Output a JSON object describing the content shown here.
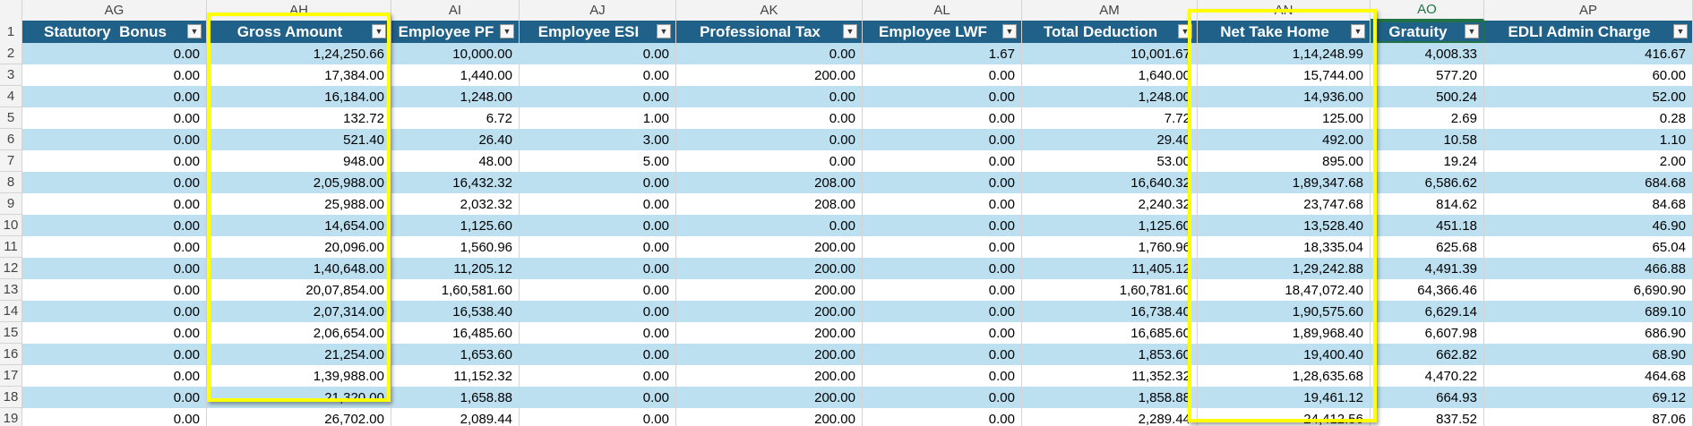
{
  "colors": {
    "header_bg": "#1f6189",
    "band": "#bde0f1",
    "highlight": "#ffff00",
    "active_column": "#217346"
  },
  "column_letters": [
    "AG",
    "AH",
    "AI",
    "AJ",
    "AK",
    "AL",
    "AM",
    "AN",
    "AO",
    "AP"
  ],
  "active_column_index": 8,
  "headers": [
    "Statutory  Bonus",
    "Gross Amount",
    "Employee PF",
    "Employee ESI",
    "Professional Tax",
    "Employee LWF",
    "Total Deduction",
    "Net Take Home",
    "Gratuity",
    "EDLI Admin Charge"
  ],
  "header_row_number": "1",
  "rows": [
    {
      "n": "2",
      "cells": [
        "0.00",
        "1,24,250.66",
        "10,000.00",
        "0.00",
        "0.00",
        "1.67",
        "10,001.67",
        "1,14,248.99",
        "4,008.33",
        "416.67"
      ]
    },
    {
      "n": "3",
      "cells": [
        "0.00",
        "17,384.00",
        "1,440.00",
        "0.00",
        "200.00",
        "0.00",
        "1,640.00",
        "15,744.00",
        "577.20",
        "60.00"
      ]
    },
    {
      "n": "4",
      "cells": [
        "0.00",
        "16,184.00",
        "1,248.00",
        "0.00",
        "0.00",
        "0.00",
        "1,248.00",
        "14,936.00",
        "500.24",
        "52.00"
      ]
    },
    {
      "n": "5",
      "cells": [
        "0.00",
        "132.72",
        "6.72",
        "1.00",
        "0.00",
        "0.00",
        "7.72",
        "125.00",
        "2.69",
        "0.28"
      ]
    },
    {
      "n": "6",
      "cells": [
        "0.00",
        "521.40",
        "26.40",
        "3.00",
        "0.00",
        "0.00",
        "29.40",
        "492.00",
        "10.58",
        "1.10"
      ]
    },
    {
      "n": "7",
      "cells": [
        "0.00",
        "948.00",
        "48.00",
        "5.00",
        "0.00",
        "0.00",
        "53.00",
        "895.00",
        "19.24",
        "2.00"
      ]
    },
    {
      "n": "8",
      "cells": [
        "0.00",
        "2,05,988.00",
        "16,432.32",
        "0.00",
        "208.00",
        "0.00",
        "16,640.32",
        "1,89,347.68",
        "6,586.62",
        "684.68"
      ]
    },
    {
      "n": "9",
      "cells": [
        "0.00",
        "25,988.00",
        "2,032.32",
        "0.00",
        "208.00",
        "0.00",
        "2,240.32",
        "23,747.68",
        "814.62",
        "84.68"
      ]
    },
    {
      "n": "10",
      "cells": [
        "0.00",
        "14,654.00",
        "1,125.60",
        "0.00",
        "0.00",
        "0.00",
        "1,125.60",
        "13,528.40",
        "451.18",
        "46.90"
      ]
    },
    {
      "n": "11",
      "cells": [
        "0.00",
        "20,096.00",
        "1,560.96",
        "0.00",
        "200.00",
        "0.00",
        "1,760.96",
        "18,335.04",
        "625.68",
        "65.04"
      ]
    },
    {
      "n": "12",
      "cells": [
        "0.00",
        "1,40,648.00",
        "11,205.12",
        "0.00",
        "200.00",
        "0.00",
        "11,405.12",
        "1,29,242.88",
        "4,491.39",
        "466.88"
      ]
    },
    {
      "n": "13",
      "cells": [
        "0.00",
        "20,07,854.00",
        "1,60,581.60",
        "0.00",
        "200.00",
        "0.00",
        "1,60,781.60",
        "18,47,072.40",
        "64,366.46",
        "6,690.90"
      ]
    },
    {
      "n": "14",
      "cells": [
        "0.00",
        "2,07,314.00",
        "16,538.40",
        "0.00",
        "200.00",
        "0.00",
        "16,738.40",
        "1,90,575.60",
        "6,629.14",
        "689.10"
      ]
    },
    {
      "n": "15",
      "cells": [
        "0.00",
        "2,06,654.00",
        "16,485.60",
        "0.00",
        "200.00",
        "0.00",
        "16,685.60",
        "1,89,968.40",
        "6,607.98",
        "686.90"
      ]
    },
    {
      "n": "16",
      "cells": [
        "0.00",
        "21,254.00",
        "1,653.60",
        "0.00",
        "200.00",
        "0.00",
        "1,853.60",
        "19,400.40",
        "662.82",
        "68.90"
      ]
    },
    {
      "n": "17",
      "cells": [
        "0.00",
        "1,39,988.00",
        "11,152.32",
        "0.00",
        "200.00",
        "0.00",
        "11,352.32",
        "1,28,635.68",
        "4,470.22",
        "464.68"
      ]
    },
    {
      "n": "18",
      "cells": [
        "0.00",
        "21,320.00",
        "1,658.88",
        "0.00",
        "200.00",
        "0.00",
        "1,858.88",
        "19,461.12",
        "664.93",
        "69.12"
      ]
    },
    {
      "n": "19",
      "cells": [
        "0.00",
        "26,702.00",
        "2,089.44",
        "0.00",
        "200.00",
        "0.00",
        "2,289.44",
        "24,412.56",
        "837.52",
        "87.06"
      ]
    }
  ],
  "icons": {
    "filter": "dropdown-arrow-icon"
  }
}
